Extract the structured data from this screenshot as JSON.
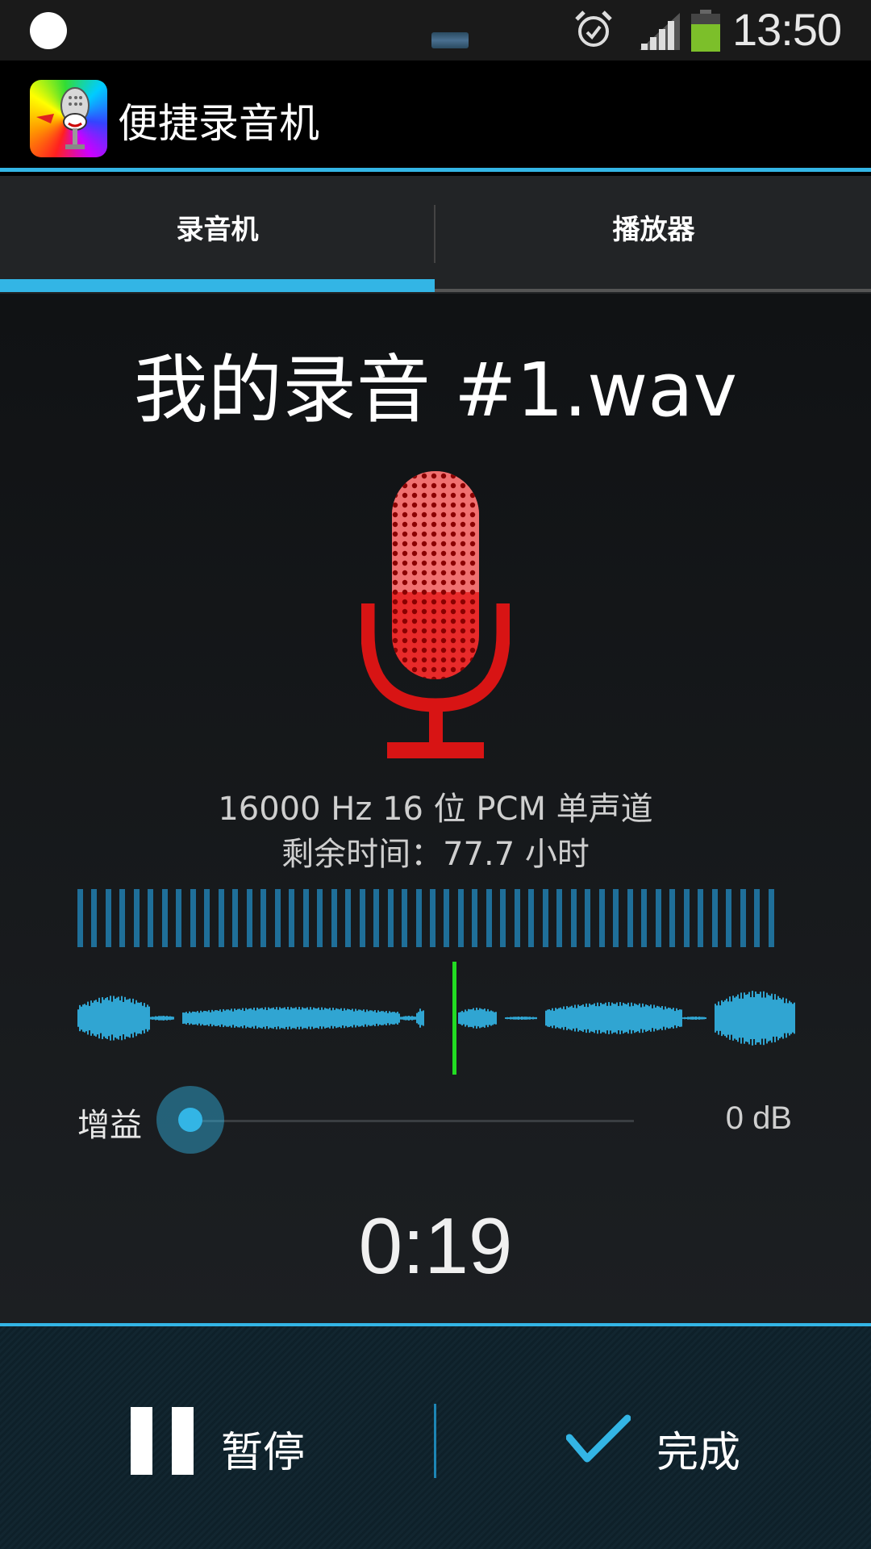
{
  "status_bar": {
    "time": "13:50",
    "icons": [
      "notification-dot-icon",
      "notification-icon",
      "alarm-icon",
      "signal-icon",
      "battery-icon"
    ]
  },
  "action_bar": {
    "app_title": "便捷录音机",
    "app_icon": "microphone-app-icon"
  },
  "tabs": [
    {
      "label": "录音机",
      "selected": true
    },
    {
      "label": "播放器",
      "selected": false
    }
  ],
  "recorder": {
    "file_name": "我的录音 #1.wav",
    "format_info": "16000 Hz 16 位 PCM 单声道",
    "remaining_time": "剩余时间：77.7 小时",
    "gain_label": "增益",
    "gain_value": "0 dB",
    "gain_level_fraction": 0.0,
    "elapsed": "0:19"
  },
  "controls": {
    "pause_label": "暂停",
    "done_label": "完成"
  },
  "colors": {
    "accent": "#33b5e5",
    "mic_red": "#d81414",
    "playhead_green": "#22dd22",
    "level_bar": "#1f6f99"
  }
}
